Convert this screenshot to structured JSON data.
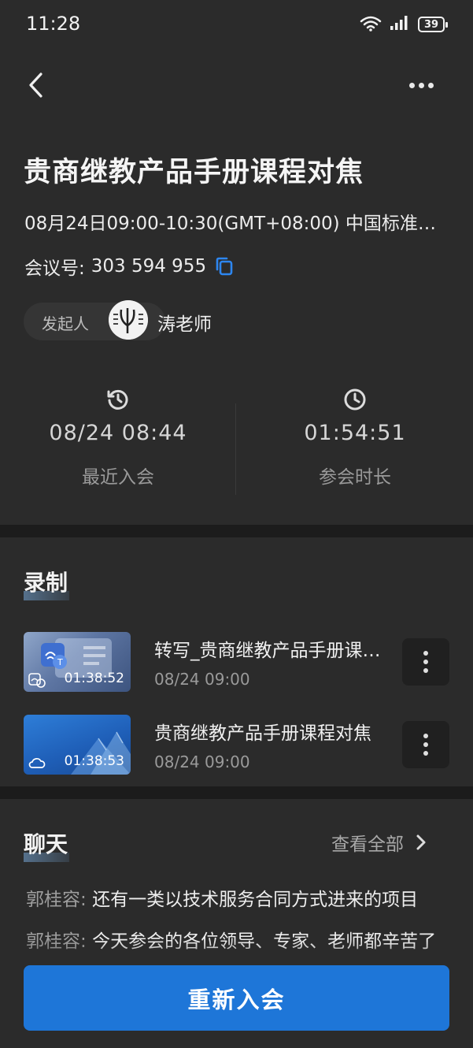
{
  "status_bar": {
    "time": "11:28",
    "battery": "39"
  },
  "header": {
    "back_icon": "chevron-left-icon",
    "more_icon": "more-horizontal-icon"
  },
  "meeting": {
    "title": "贵商继教产品手册课程对焦",
    "time_range": "08月24日09:00-10:30(GMT+08:00) 中国标准时间",
    "id_label": "会议号:",
    "id_value": "303 594 955",
    "host_label": "发起人",
    "host_name": "涛老师"
  },
  "stats": {
    "last_join": {
      "value": "08/24 08:44",
      "label": "最近入会",
      "icon": "history-clock-icon"
    },
    "duration": {
      "value": "01:54:51",
      "label": "参会时长",
      "icon": "clock-icon"
    }
  },
  "recordings": {
    "title": "录制",
    "items": [
      {
        "name": "转写_贵商继教产品手册课程对焦",
        "date": "08/24 09:00",
        "duration": "01:38:52"
      },
      {
        "name": "贵商继教产品手册课程对焦",
        "date": "08/24 09:00",
        "duration": "01:38:53"
      }
    ]
  },
  "chat": {
    "title": "聊天",
    "view_all": "查看全部",
    "messages": [
      {
        "sender": "郭桂容:",
        "text": "还有一类以技术服务合同方式进来的项目"
      },
      {
        "sender": "郭桂容:",
        "text": "今天参会的各位领导、专家、老师都辛苦了"
      }
    ]
  },
  "actions": {
    "rejoin": "重新入会"
  },
  "colors": {
    "accent": "#1e76d8",
    "background": "#2b2b2b",
    "separator": "#1c1c1c"
  }
}
